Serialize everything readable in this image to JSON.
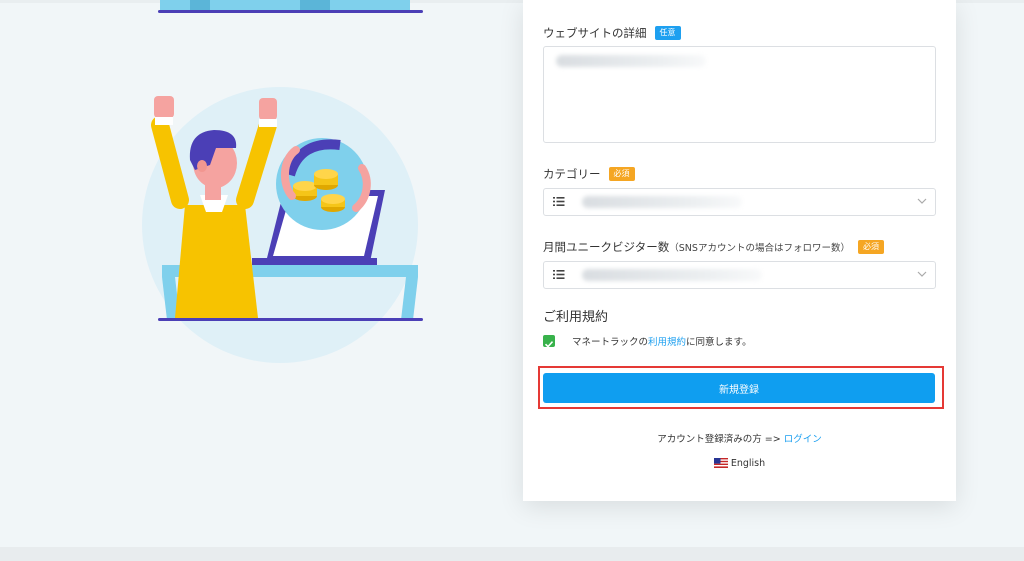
{
  "form": {
    "website_details": {
      "label": "ウェブサイトの詳細",
      "badge": "任意"
    },
    "category": {
      "label": "カテゴリー",
      "badge": "必須"
    },
    "monthly_visitors": {
      "label": "月間ユニークビジター数",
      "sublabel": "（SNSアカウントの場合はフォロワー数）",
      "badge": "必須"
    },
    "terms": {
      "title": "ご利用規約",
      "checked": true,
      "text_before": "マネートラックの",
      "link": "利用規約",
      "text_after": "に同意します。"
    },
    "submit_label": "新規登録",
    "login_prompt": "アカウント登録済みの方 =>",
    "login_link": "ログイン",
    "language": "English"
  },
  "colors": {
    "accent": "#0f9ef0",
    "required_badge": "#f5a623",
    "optional_badge": "#1ea0f0",
    "checkbox": "#38b24b",
    "highlight": "#e53935"
  },
  "icons": [
    "list-icon",
    "chevron-down-icon",
    "check-icon",
    "us-flag-icon"
  ]
}
